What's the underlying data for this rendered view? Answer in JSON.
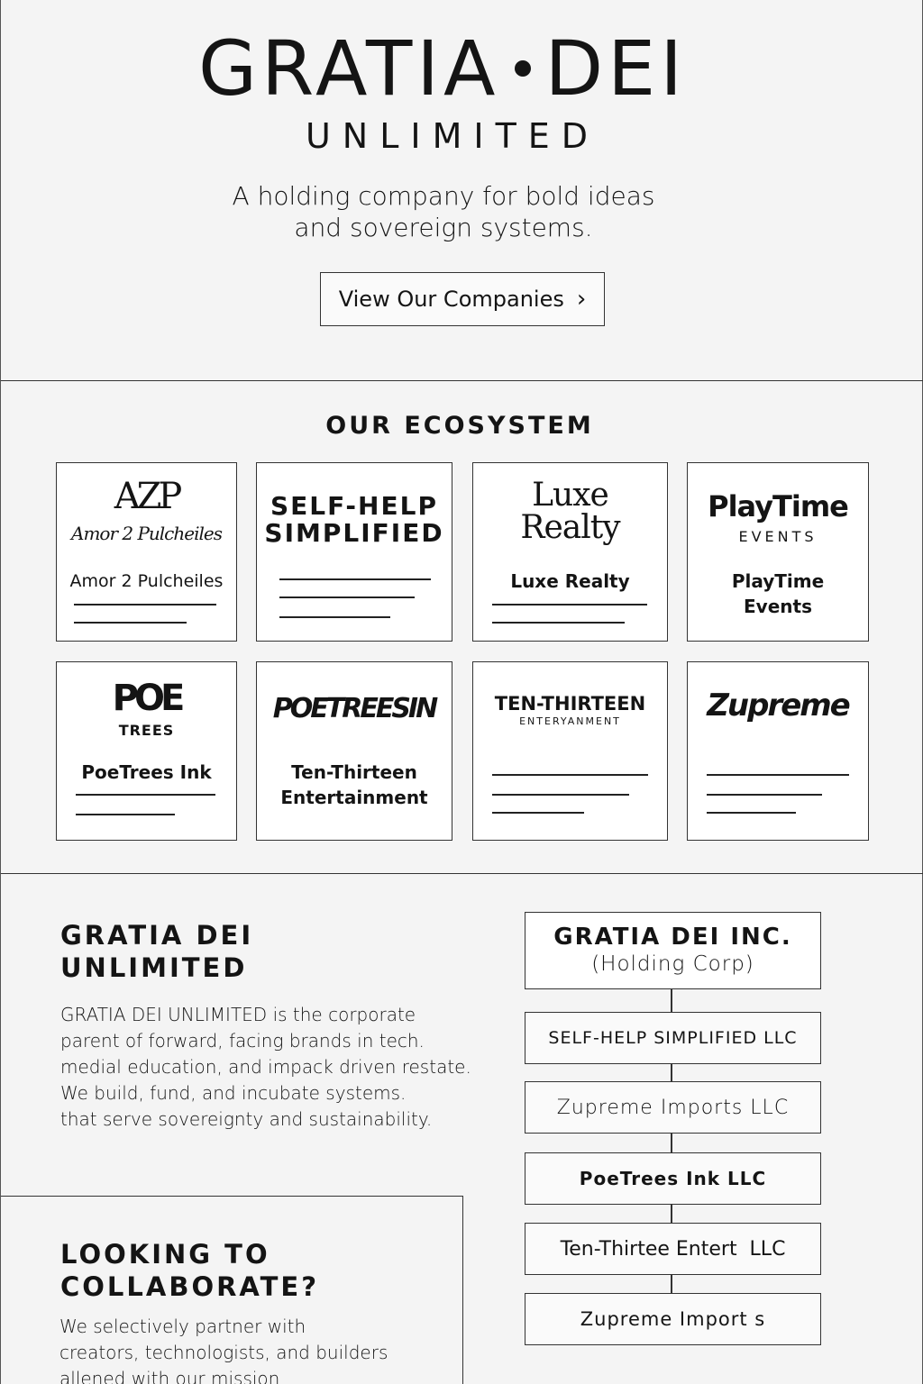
{
  "hero": {
    "title_left": "GRATIA",
    "title_right": "DEI",
    "subtitle": "UNLIMITED",
    "tagline_line1": "A holding company for bold ideas",
    "tagline_line2": "and sovereign systems.",
    "cta_label": "View Our Companies",
    "cta_icon": "chevron-right-icon"
  },
  "ecosystem": {
    "heading": "OUR ECOSYSTEM",
    "cards": [
      {
        "logo_monogram": "AZP",
        "logo_script": "Amor 2 Pulcheiles",
        "name": "Amor 2 Pulcheiles"
      },
      {
        "logo_line1": "SELF-HELP",
        "logo_line2": "SIMPLIFIED"
      },
      {
        "logo_line1": "Luxe",
        "logo_line2": "Realty",
        "name": "Luxe Realty"
      },
      {
        "logo_line1": "PlayTime",
        "logo_line2": "EVENTS",
        "name_line1": "PlayTime",
        "name_line2": "Events"
      },
      {
        "logo_line1": "POE",
        "logo_line2": "TREES",
        "name": "PoeTrees Ink"
      },
      {
        "logo_line1": "POETREESIN",
        "name_line1": "Ten-Thirteen",
        "name_line2": "Entertainment"
      },
      {
        "logo_line1": "TEN-THIRTEEN",
        "logo_line2": "ENTERYANMENT"
      },
      {
        "logo_line1": "Zupreme"
      }
    ]
  },
  "about": {
    "title_line1": "GRATIA DEI",
    "title_line2": "UNLIMITED",
    "body": [
      "GRATIA DEI UNLIMITED  is the corporate",
      "parent of forward, facing brands in tech.",
      "medial education, and impack driven restate.",
      "We build, fund, and incubate systems.",
      "that serve sovereignty and sustainability."
    ]
  },
  "collaborate": {
    "title_line1": "LOOKING TO",
    "title_line2": "COLLABORATE?",
    "body": [
      "We selectively partner with",
      "creators, technologists, and builders",
      "allened with our mission"
    ]
  },
  "org_chart": {
    "parent_line1": "GRATIA DEI INC.",
    "parent_line2": "(Holding Corp)",
    "children": [
      "SELF-HELP SIMPLIFIED LLC",
      "Zupreme Imports LLC",
      "PoeTrees Ink LLC",
      "Ten-Thirtee Entert  LLC",
      "Zupreme Import s"
    ]
  }
}
